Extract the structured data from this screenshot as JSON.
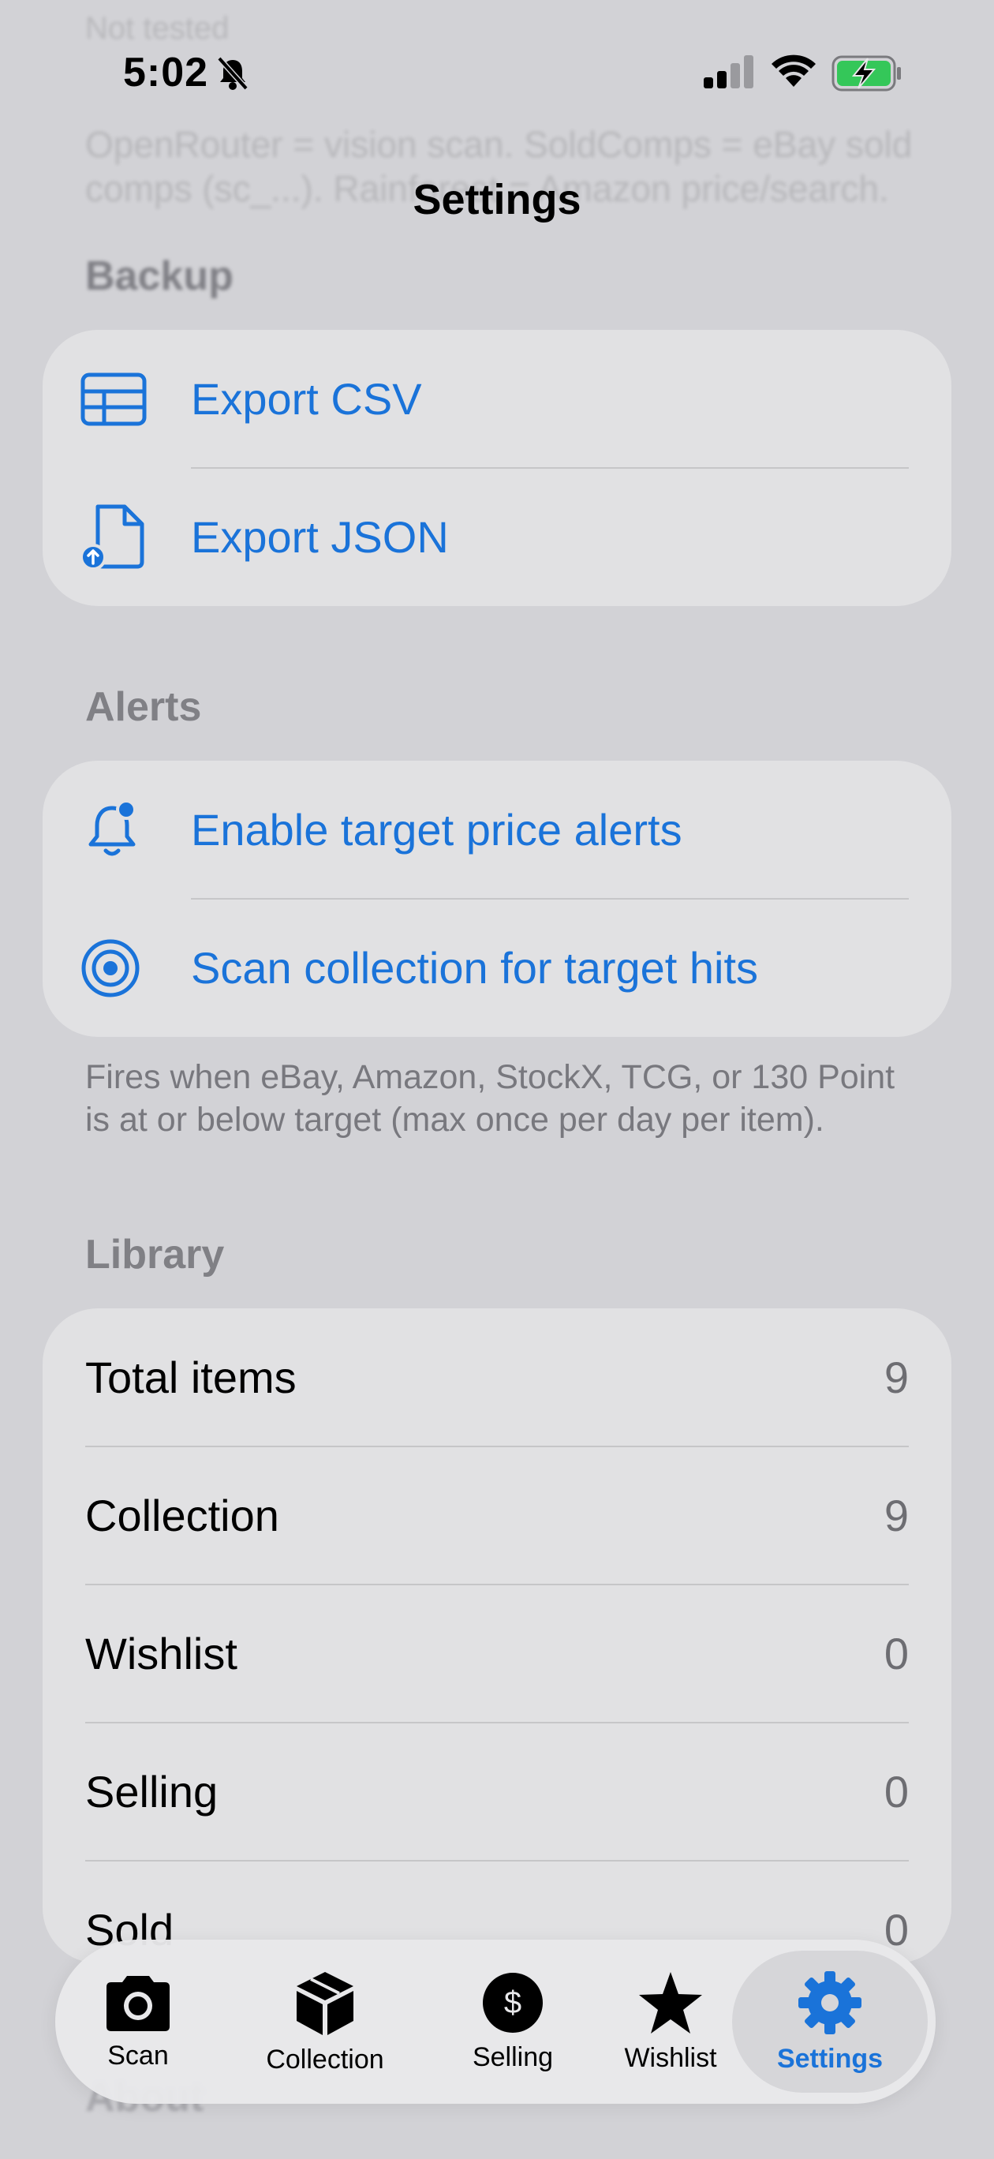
{
  "background_text": {
    "line1": "Not tested",
    "line2": "OpenRouter = vision scan. SoldComps = eBay sold",
    "line3": "comps (sc_...). Rainforest = Amazon price/search."
  },
  "status_bar": {
    "time": "5:02"
  },
  "nav": {
    "title": "Settings"
  },
  "backup": {
    "header": "Backup",
    "items": [
      {
        "label": "Export CSV",
        "icon": "table-icon"
      },
      {
        "label": "Export JSON",
        "icon": "document-upload-icon"
      }
    ]
  },
  "alerts": {
    "header": "Alerts",
    "items": [
      {
        "label": "Enable target price alerts",
        "icon": "bell-badge-icon"
      },
      {
        "label": "Scan collection for target hits",
        "icon": "target-icon"
      }
    ],
    "footnote": "Fires when eBay, Amazon, StockX, TCG, or 130 Point is at or below target (max once per day per item)."
  },
  "library": {
    "header": "Library",
    "rows": [
      {
        "label": "Total items",
        "value": "9"
      },
      {
        "label": "Collection",
        "value": "9"
      },
      {
        "label": "Wishlist",
        "value": "0"
      },
      {
        "label": "Selling",
        "value": "0"
      },
      {
        "label": "Sold",
        "value": "0"
      }
    ]
  },
  "about": {
    "header": "About"
  },
  "tabbar": {
    "tabs": [
      {
        "label": "Scan",
        "icon": "camera-icon"
      },
      {
        "label": "Collection",
        "icon": "box-icon"
      },
      {
        "label": "Selling",
        "icon": "dollar-circle-icon"
      },
      {
        "label": "Wishlist",
        "icon": "star-icon"
      },
      {
        "label": "Settings",
        "icon": "gear-icon"
      }
    ],
    "active": "Settings"
  },
  "colors": {
    "accent": "#1a73d9",
    "background": "#d2d2d6",
    "card": "#e1e1e3",
    "battery_green": "#34c759"
  }
}
